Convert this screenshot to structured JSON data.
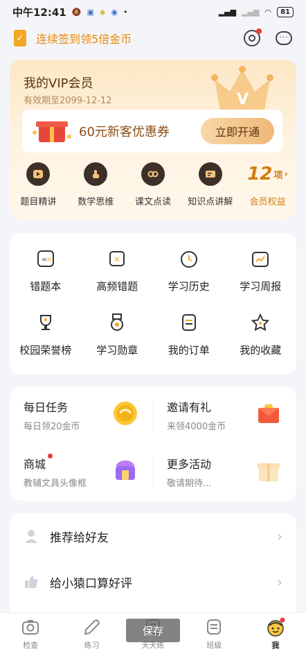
{
  "status_bar": {
    "time": "中午12:41",
    "battery": "81"
  },
  "sign_in": {
    "text": "连续签到领5倍金币"
  },
  "vip": {
    "title": "我的VIP会员",
    "expiry": "有效期至2099-12-12",
    "coupon_text": "60元新客优惠券",
    "open_button": "立即开通",
    "benefits": [
      {
        "label": "题目精讲"
      },
      {
        "label": "数学思维"
      },
      {
        "label": "课文点读"
      },
      {
        "label": "知识点讲解"
      }
    ],
    "more_count": "12",
    "more_unit": "项",
    "more_label": "会员权益"
  },
  "tools": [
    {
      "label": "错题本"
    },
    {
      "label": "高频错题"
    },
    {
      "label": "学习历史"
    },
    {
      "label": "学习周报"
    },
    {
      "label": "校园荣誉榜"
    },
    {
      "label": "学习勋章"
    },
    {
      "label": "我的订单"
    },
    {
      "label": "我的收藏"
    }
  ],
  "tasks": [
    {
      "title": "每日任务",
      "sub": "每日领20金币"
    },
    {
      "title": "邀请有礼",
      "sub": "来领4000金币"
    },
    {
      "title": "商城",
      "sub": "教辅文具头像框"
    },
    {
      "title": "更多活动",
      "sub": "敬请期待..."
    }
  ],
  "list": [
    {
      "label": "推荐给好友"
    },
    {
      "label": "给小猿口算好评"
    }
  ],
  "tabs": [
    {
      "label": "检查"
    },
    {
      "label": "练习"
    },
    {
      "label": "天天练"
    },
    {
      "label": "班级"
    },
    {
      "label": "我"
    }
  ],
  "toast": "保存",
  "colors": {
    "accent": "#e8890c",
    "vip_gold": "#d27d12",
    "badge_red": "#e63b3b"
  }
}
